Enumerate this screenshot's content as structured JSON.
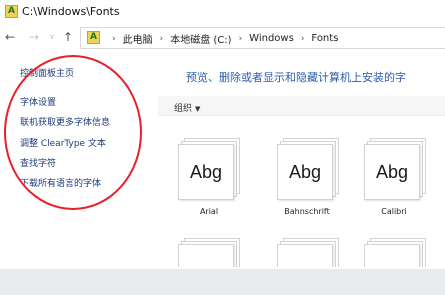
{
  "window": {
    "title": "C:\\Windows\\Fonts"
  },
  "addressbar": {
    "crumbs": [
      "此电脑",
      "本地磁盘 (C:)",
      "Windows",
      "Fonts"
    ]
  },
  "sidebar": {
    "items": [
      {
        "label": "控制面板主页"
      },
      {
        "label": "字体设置"
      },
      {
        "label": "联机获取更多字体信息"
      },
      {
        "label": "调整 ClearType 文本"
      },
      {
        "label": "查找字符"
      },
      {
        "label": "下载所有语言的字体"
      }
    ]
  },
  "main": {
    "heading": "预览、删除或者显示和隐藏计算机上安装的字",
    "toolbar": {
      "organize_label": "组织"
    },
    "fonts": [
      {
        "sample": "Abg",
        "name": "Arial"
      },
      {
        "sample": "Abg",
        "name": "Bahnschrift"
      },
      {
        "sample": "Abg",
        "name": "Calibri"
      }
    ]
  },
  "colors": {
    "link": "#1e3c78",
    "heading": "#2d5ea8",
    "annotation": "#e8202a"
  }
}
